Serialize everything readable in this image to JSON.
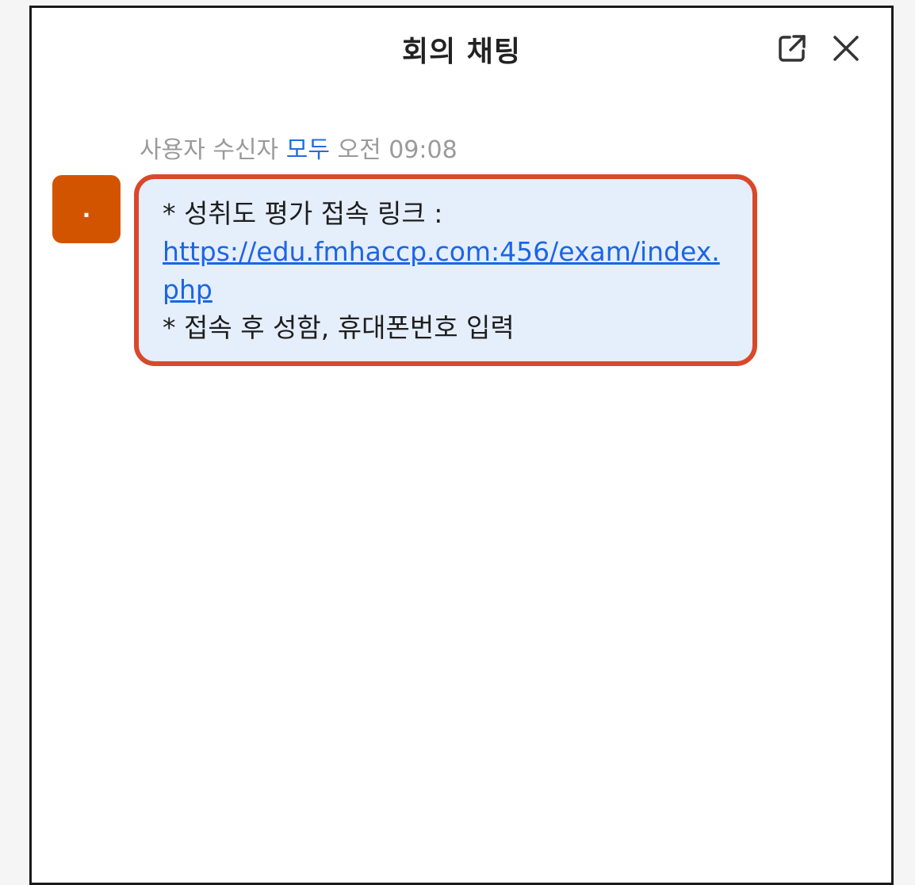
{
  "window": {
    "title": "회의 채팅"
  },
  "header": {
    "popout_icon": "external-link-icon",
    "close_icon": "close-icon"
  },
  "message": {
    "sender": "사용자",
    "to_label": "수신자",
    "recipient": "모두",
    "time": "오전 09:08",
    "avatar_text": ".",
    "avatar_color": "#d35400",
    "line1": "* 성취도 평가 접속 링크 :",
    "link": "https://edu.fmhaccp.com:456/exam/index.php",
    "line3": "* 접속 후 성함, 휴대폰번호 입력"
  },
  "colors": {
    "highlight_border": "#d9482b",
    "bubble_bg": "#e5eefb",
    "link": "#1a66e6",
    "recipient": "#1f6fe0"
  }
}
